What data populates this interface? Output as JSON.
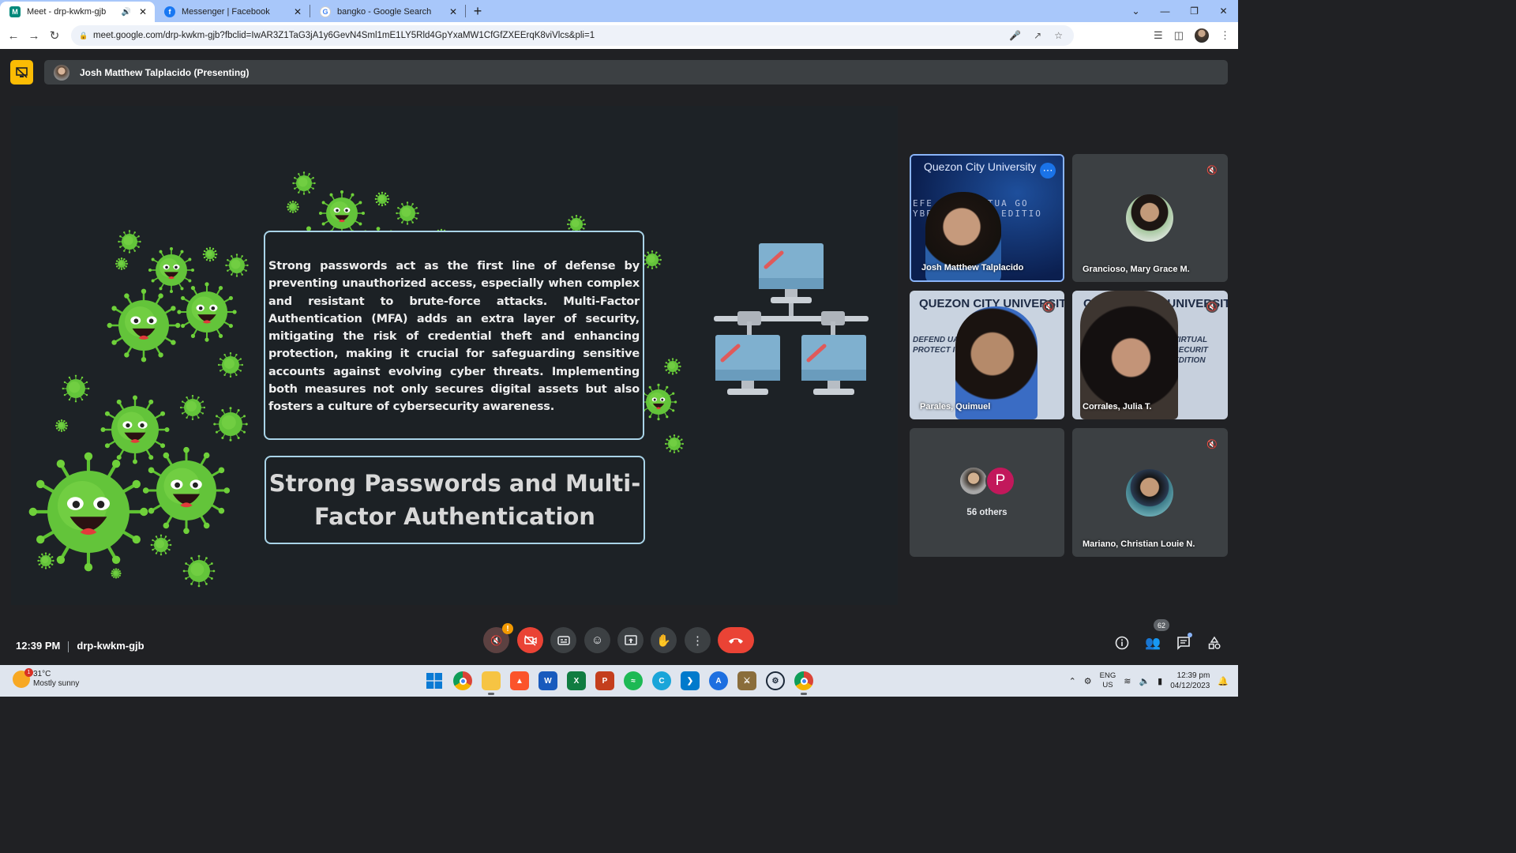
{
  "browser": {
    "tabs": [
      {
        "title": "Meet - drp-kwkm-gjb",
        "active": true,
        "audio": true
      },
      {
        "title": "Messenger | Facebook",
        "active": false
      },
      {
        "title": "bangko - Google Search",
        "active": false
      }
    ],
    "url": "meet.google.com/drp-kwkm-gjb?fbclid=IwAR3Z1TaG3jA1y6GevN4Sml1mE1LY5Rld4GpYxaMW1CfGfZXEErqK8viVlcs&pli=1"
  },
  "meet": {
    "presenter": "Josh Matthew Talplacido (Presenting)",
    "slide": {
      "body": "Strong passwords act as the first line of defense by preventing unauthorized access, especially when complex and resistant to brute-force attacks. Multi-Factor Authentication (MFA) adds an extra layer of security, mitigating the risk of credential theft and enhancing protection, making it crucial for safeguarding sensitive accounts against evolving cyber threats. Implementing both measures not only secures digital assets but also fosters a culture of cybersecurity awareness.",
      "title": "Strong Passwords and Multi-Factor Authentication"
    },
    "participants": [
      {
        "name": "Josh Matthew Talplacido",
        "banner": "Quezon City University",
        "overlay": "EFE  THE VIRTUA GO  YBERSECUR RO  EDITIO"
      },
      {
        "name": "Grancioso, Mary Grace M."
      },
      {
        "name": "Parales, Quimuel",
        "banner": "QUEZON CITY UNIVERSITY",
        "overlay": "DEFEND  UAL INGDOM: URIT PROTECT  ION"
      },
      {
        "name": "Corrales, Julia T.",
        "banner": "QUEZON CITY UNIVERSITY",
        "overlay": "VIRTUAL SECURIT EDITION"
      },
      {
        "name": "56 others",
        "initial": "P"
      },
      {
        "name": "Mariano, Christian Louie N."
      }
    ],
    "time": "12:39 PM",
    "meeting_code": "drp-kwkm-gjb",
    "people_count": "62",
    "colors": {
      "accent": "#1a73e8",
      "danger": "#ea4335",
      "present": "#fbbc04"
    }
  },
  "taskbar": {
    "weather_temp": "31°C",
    "weather_desc": "Mostly sunny",
    "weather_badge": "1",
    "lang_top": "ENG",
    "lang_bottom": "US",
    "time": "12:39 pm",
    "date": "04/12/2023"
  }
}
